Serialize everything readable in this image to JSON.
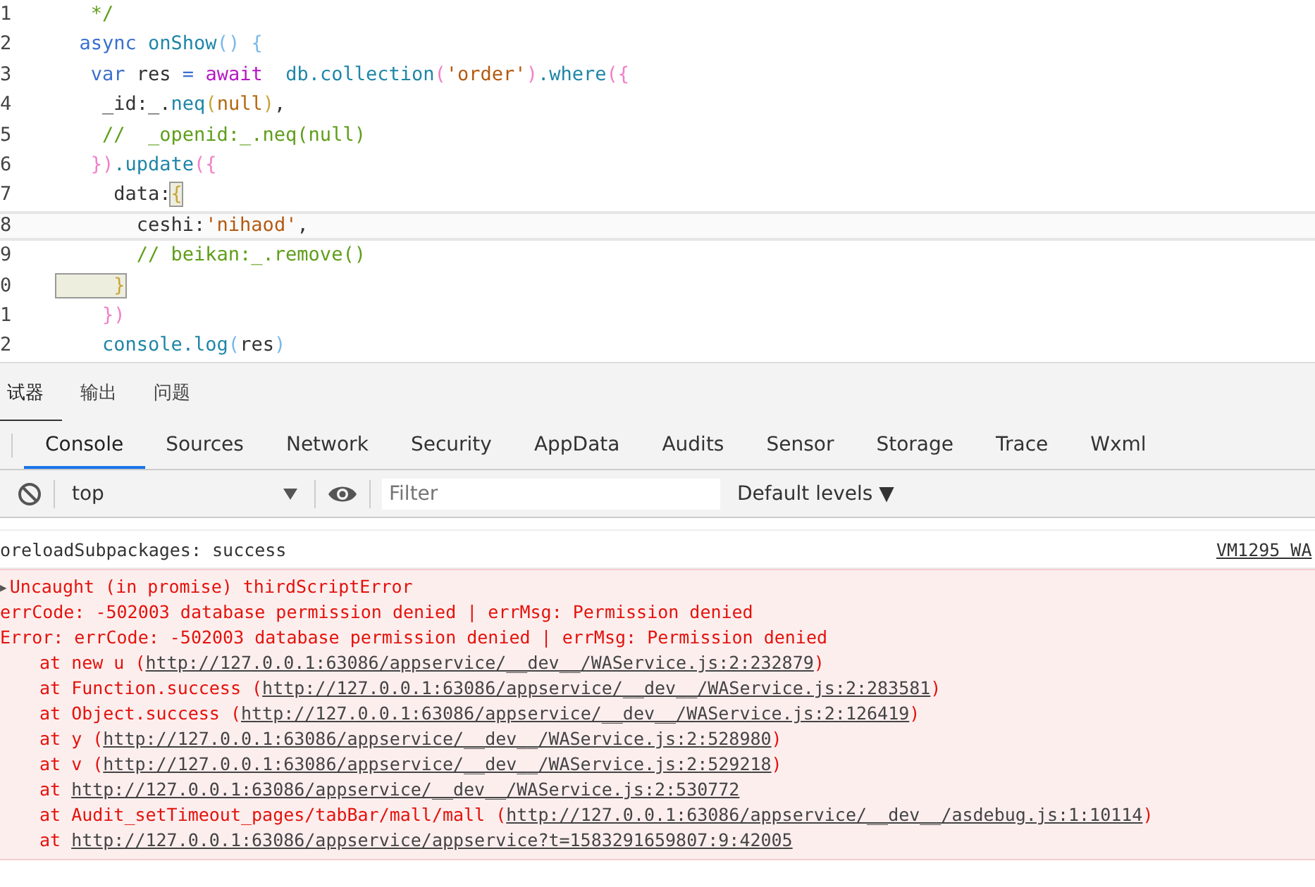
{
  "editor": {
    "lines": [
      {
        "number": "1",
        "current": false,
        "tokens": [
          {
            "kind": "cmt",
            "text": "   */"
          }
        ]
      },
      {
        "number": "2",
        "current": false,
        "tokens": [
          {
            "kind": "kw",
            "text": "  async"
          },
          {
            "kind": "fn",
            "text": " onShow"
          },
          {
            "kind": "paren",
            "text": "() {"
          }
        ]
      },
      {
        "number": "3",
        "current": false,
        "tokens": [
          {
            "kind": "kw",
            "text": "   var"
          },
          {
            "kind": "plain",
            "text": " res "
          },
          {
            "kind": "op",
            "text": "= "
          },
          {
            "kind": "kw2",
            "text": "await  "
          },
          {
            "kind": "fn",
            "text": "db.collection"
          },
          {
            "kind": "brace",
            "text": "("
          },
          {
            "kind": "str",
            "text": "'order'"
          },
          {
            "kind": "brace",
            "text": ")"
          },
          {
            "kind": "fn",
            "text": ".where"
          },
          {
            "kind": "brace",
            "text": "({"
          }
        ]
      },
      {
        "number": "4",
        "current": false,
        "tokens": [
          {
            "kind": "plain",
            "text": "    _id:_."
          },
          {
            "kind": "fn",
            "text": "neq"
          },
          {
            "kind": "curly",
            "text": "("
          },
          {
            "kind": "lit",
            "text": "null"
          },
          {
            "kind": "curly",
            "text": ")"
          },
          {
            "kind": "plain",
            "text": ","
          }
        ]
      },
      {
        "number": "5",
        "current": false,
        "tokens": [
          {
            "kind": "cmt",
            "text": "    //  _openid:_.neq(null)"
          }
        ]
      },
      {
        "number": "6",
        "current": false,
        "tokens": [
          {
            "kind": "brace",
            "text": "   })"
          },
          {
            "kind": "fn",
            "text": ".update"
          },
          {
            "kind": "brace",
            "text": "({"
          }
        ]
      },
      {
        "number": "7",
        "current": false,
        "tokens": [
          {
            "kind": "plain",
            "text": "     data:"
          },
          {
            "kind": "match",
            "text": "{"
          }
        ]
      },
      {
        "number": "8",
        "current": true,
        "tokens": [
          {
            "kind": "plain",
            "text": "       ceshi:"
          },
          {
            "kind": "str",
            "text": "'nihaod'"
          },
          {
            "kind": "plain",
            "text": ","
          }
        ]
      },
      {
        "number": "9",
        "current": false,
        "tokens": [
          {
            "kind": "cmt",
            "text": "       // beikan:_.remove()"
          }
        ]
      },
      {
        "number": "0",
        "current": false,
        "tokens": [
          {
            "kind": "match",
            "text": "     }"
          }
        ]
      },
      {
        "number": "1",
        "current": false,
        "tokens": [
          {
            "kind": "brace",
            "text": "    })"
          }
        ]
      },
      {
        "number": "2",
        "current": false,
        "tokens": [
          {
            "kind": "fn",
            "text": "    console.log"
          },
          {
            "kind": "paren",
            "text": "("
          },
          {
            "kind": "plain",
            "text": "res"
          },
          {
            "kind": "paren",
            "text": ")"
          }
        ]
      }
    ]
  },
  "panel_tabs": [
    {
      "label": "试器",
      "selected": true
    },
    {
      "label": "输出",
      "selected": false
    },
    {
      "label": "问题",
      "selected": false
    }
  ],
  "devtools_tabs": [
    {
      "label": "Console",
      "selected": true
    },
    {
      "label": "Sources",
      "selected": false
    },
    {
      "label": "Network",
      "selected": false
    },
    {
      "label": "Security",
      "selected": false
    },
    {
      "label": "AppData",
      "selected": false
    },
    {
      "label": "Audits",
      "selected": false
    },
    {
      "label": "Sensor",
      "selected": false
    },
    {
      "label": "Storage",
      "selected": false
    },
    {
      "label": "Trace",
      "selected": false
    },
    {
      "label": "Wxml",
      "selected": false
    }
  ],
  "toolbar": {
    "context": "top",
    "filter": {
      "placeholder": "Filter"
    },
    "levels": "Default levels",
    "levels_caret": "▼"
  },
  "messages": [
    {
      "kind": "log",
      "text": "oreloadSubpackages: success",
      "source": "VM1295 WA"
    }
  ],
  "error": {
    "arrow": "▶",
    "header": "Uncaught (in promise) thirdScriptError",
    "lines": [
      "errCode: -502003 database permission denied | errMsg: Permission denied",
      "Error: errCode: -502003 database permission denied | errMsg: Permission denied"
    ],
    "stack": [
      {
        "before": "at new u (",
        "url": "http://127.0.0.1:63086/appservice/__dev__/WAService.js:2:232879",
        "after": ")"
      },
      {
        "before": "at Function.success (",
        "url": "http://127.0.0.1:63086/appservice/__dev__/WAService.js:2:283581",
        "after": ")"
      },
      {
        "before": "at Object.success (",
        "url": "http://127.0.0.1:63086/appservice/__dev__/WAService.js:2:126419",
        "after": ")"
      },
      {
        "before": "at y (",
        "url": "http://127.0.0.1:63086/appservice/__dev__/WAService.js:2:528980",
        "after": ")"
      },
      {
        "before": "at v (",
        "url": "http://127.0.0.1:63086/appservice/__dev__/WAService.js:2:529218",
        "after": ")"
      },
      {
        "before": "at ",
        "url": "http://127.0.0.1:63086/appservice/__dev__/WAService.js:2:530772"
      },
      {
        "before": "at Audit_setTimeout_pages/tabBar/mall/mall (",
        "url": "http://127.0.0.1:63086/appservice/__dev__/asdebug.js:1:10114",
        "after": ")"
      },
      {
        "before": "at ",
        "url": "http://127.0.0.1:63086/appservice/appservice?t=1583291659807:9:42005"
      }
    ]
  }
}
